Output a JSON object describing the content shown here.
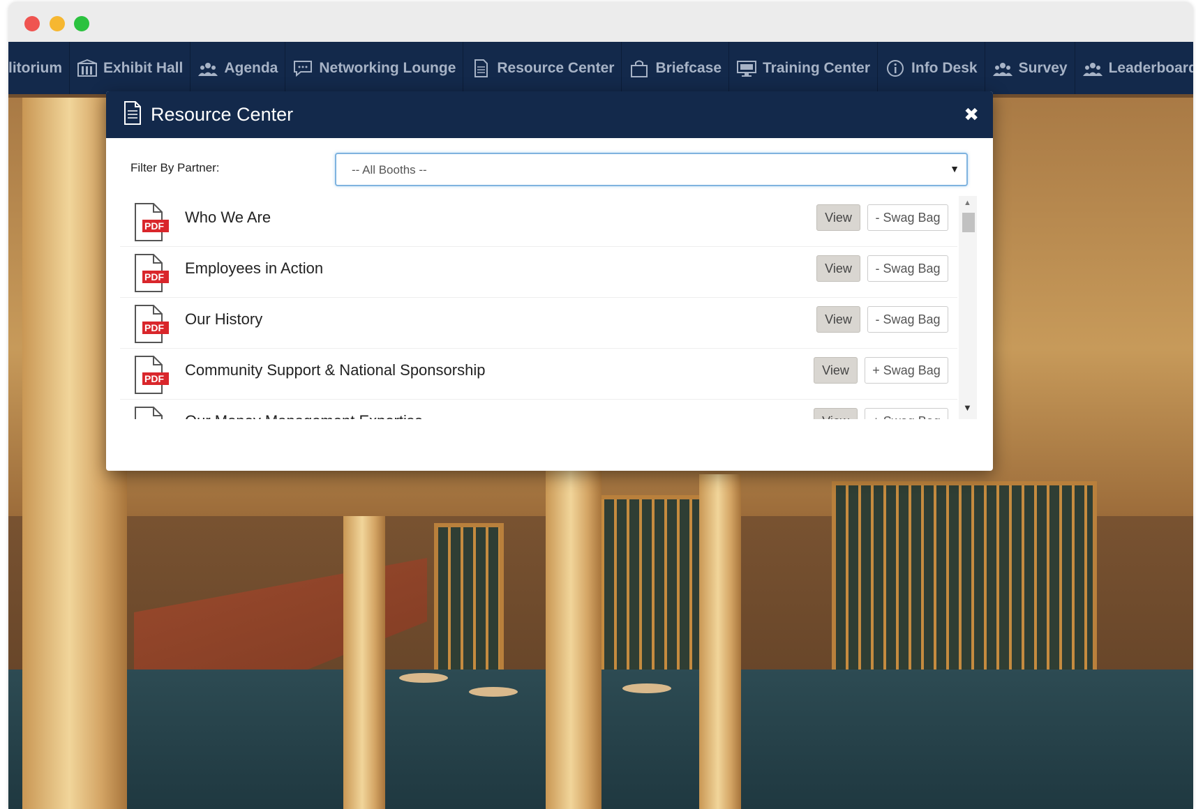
{
  "nav": {
    "items": [
      {
        "label": "litorium",
        "icon": "auditorium-icon"
      },
      {
        "label": "Exhibit Hall",
        "icon": "building-icon"
      },
      {
        "label": "Agenda",
        "icon": "crowd-icon"
      },
      {
        "label": "Networking Lounge",
        "icon": "chat-icon"
      },
      {
        "label": "Resource Center",
        "icon": "document-icon"
      },
      {
        "label": "Briefcase",
        "icon": "bag-icon"
      },
      {
        "label": "Training Center",
        "icon": "monitor-icon"
      },
      {
        "label": "Info Desk",
        "icon": "info-icon"
      },
      {
        "label": "Survey",
        "icon": "crowd-icon"
      },
      {
        "label": "Leaderboard",
        "icon": "crowd-icon"
      }
    ]
  },
  "modal": {
    "title": "Resource Center",
    "close_glyph": "✖",
    "filter_label": "Filter By Partner:",
    "filter_value": "-- All Booths --",
    "pdf_badge": "PDF",
    "view_label": "View",
    "resources": [
      {
        "title": "Who We Are",
        "swag": "- Swag Bag"
      },
      {
        "title": "Employees in Action",
        "swag": "- Swag Bag"
      },
      {
        "title": "Our History",
        "swag": "- Swag Bag"
      },
      {
        "title": "Community Support & National Sponsorship",
        "swag": "+ Swag Bag"
      },
      {
        "title": "Our Money Management Expertise",
        "swag": "+ Swag Bag"
      }
    ]
  },
  "colors": {
    "navy": "#13294b",
    "pdf_red": "#d9262b",
    "focus_border": "#7fb3df"
  }
}
